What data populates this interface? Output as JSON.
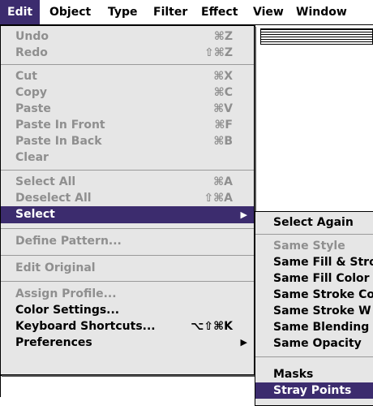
{
  "menubar": {
    "items": [
      {
        "label": "Edit"
      },
      {
        "label": "Object"
      },
      {
        "label": "Type"
      },
      {
        "label": "Filter"
      },
      {
        "label": "Effect"
      },
      {
        "label": "View"
      },
      {
        "label": "Window"
      }
    ]
  },
  "edit_menu": {
    "items": [
      {
        "label": "Undo",
        "shortcut": "⌘Z",
        "enabled": false
      },
      {
        "label": "Redo",
        "shortcut": "⇧⌘Z",
        "enabled": false
      },
      {
        "label": "Cut",
        "shortcut": "⌘X",
        "enabled": false
      },
      {
        "label": "Copy",
        "shortcut": "⌘C",
        "enabled": false
      },
      {
        "label": "Paste",
        "shortcut": "⌘V",
        "enabled": false
      },
      {
        "label": "Paste In Front",
        "shortcut": "⌘F",
        "enabled": false
      },
      {
        "label": "Paste In Back",
        "shortcut": "⌘B",
        "enabled": false
      },
      {
        "label": "Clear",
        "shortcut": "",
        "enabled": false
      },
      {
        "label": "Select All",
        "shortcut": "⌘A",
        "enabled": false
      },
      {
        "label": "Deselect All",
        "shortcut": "⇧⌘A",
        "enabled": false
      },
      {
        "label": "Select",
        "shortcut": "",
        "enabled": true,
        "submenu": true,
        "highlighted": true
      },
      {
        "label": "Define Pattern...",
        "shortcut": "",
        "enabled": false
      },
      {
        "label": "Edit Original",
        "shortcut": "",
        "enabled": false
      },
      {
        "label": "Assign Profile...",
        "shortcut": "",
        "enabled": false
      },
      {
        "label": "Color Settings...",
        "shortcut": "",
        "enabled": true
      },
      {
        "label": "Keyboard Shortcuts...",
        "shortcut": "⌥⇧⌘K",
        "enabled": true
      },
      {
        "label": "Preferences",
        "shortcut": "",
        "enabled": true,
        "submenu": true
      }
    ]
  },
  "select_submenu": {
    "items": [
      {
        "label": "Select Again",
        "enabled": true
      },
      {
        "label": "Same Style",
        "enabled": false
      },
      {
        "label": "Same Fill & Stro",
        "enabled": true
      },
      {
        "label": "Same Fill Color",
        "enabled": true
      },
      {
        "label": "Same Stroke Co",
        "enabled": true
      },
      {
        "label": "Same Stroke W",
        "enabled": true
      },
      {
        "label": "Same Blending",
        "enabled": true
      },
      {
        "label": "Same Opacity",
        "enabled": true
      },
      {
        "label": "Masks",
        "enabled": true
      },
      {
        "label": "Stray Points",
        "enabled": true,
        "highlighted": true
      }
    ]
  },
  "colors": {
    "highlight": "#3c2c6e",
    "menu_bg": "#e6e6e6",
    "disabled_text": "#8f8f8f"
  }
}
